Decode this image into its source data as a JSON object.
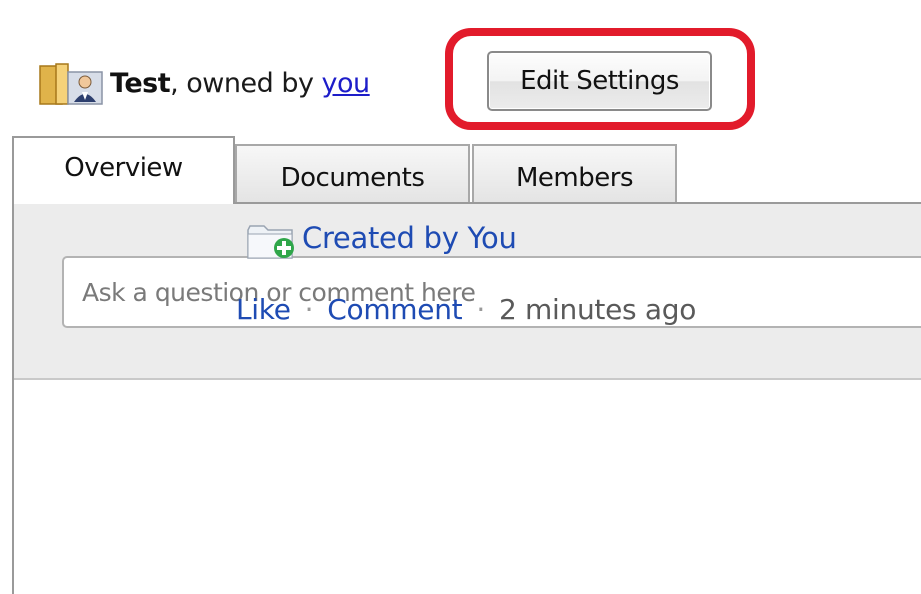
{
  "header": {
    "group_name": "Test",
    "owned_prefix": ", owned by ",
    "owner": "you",
    "edit_settings_label": "Edit Settings"
  },
  "tabs": [
    {
      "label": "Overview",
      "active": true
    },
    {
      "label": "Documents",
      "active": false
    },
    {
      "label": "Members",
      "active": false
    }
  ],
  "composer": {
    "placeholder": "Ask a question or comment here"
  },
  "activity": {
    "title": "Created by You",
    "like_label": "Like",
    "separator": "·",
    "comment_label": "Comment",
    "timestamp": "2 minutes ago"
  },
  "icons": {
    "group": "group-folder-icon",
    "activity": "folder-add-icon"
  },
  "colors": {
    "link": "#1e4bb3",
    "highlight": "#e21b2b",
    "panel_bg": "#ececec"
  }
}
